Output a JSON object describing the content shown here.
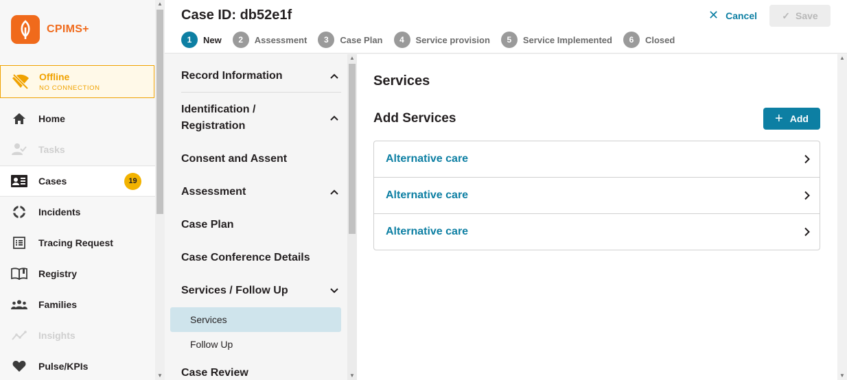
{
  "app": {
    "name": "CPIMS+",
    "brand_color": "#f06a1b",
    "accent_color": "#0d7fa3"
  },
  "connection": {
    "status": "Offline",
    "detail": "NO CONNECTION",
    "color": "#f0a200"
  },
  "nav": {
    "items": [
      {
        "label": "Home",
        "icon": "home-icon",
        "disabled": false
      },
      {
        "label": "Tasks",
        "icon": "tasks-icon",
        "disabled": true
      },
      {
        "label": "Cases",
        "icon": "cases-icon",
        "disabled": false,
        "badge": "19",
        "active": true
      },
      {
        "label": "Incidents",
        "icon": "incidents-icon",
        "disabled": false
      },
      {
        "label": "Tracing Request",
        "icon": "tracing-request-icon",
        "disabled": false
      },
      {
        "label": "Registry",
        "icon": "registry-icon",
        "disabled": false
      },
      {
        "label": "Families",
        "icon": "families-icon",
        "disabled": false
      },
      {
        "label": "Insights",
        "icon": "insights-icon",
        "disabled": true
      },
      {
        "label": "Pulse/KPIs",
        "icon": "heart-icon",
        "disabled": false
      }
    ]
  },
  "header": {
    "title": "Case ID: db52e1f",
    "cancel_label": "Cancel",
    "save_label": "Save",
    "steps": [
      {
        "number": "1",
        "label": "New",
        "current": true
      },
      {
        "number": "2",
        "label": "Assessment"
      },
      {
        "number": "3",
        "label": "Case Plan"
      },
      {
        "number": "4",
        "label": "Service provision"
      },
      {
        "number": "5",
        "label": "Service Implemented"
      },
      {
        "number": "6",
        "label": "Closed"
      }
    ]
  },
  "sections": {
    "items": [
      {
        "label": "Record Information",
        "chevron": "up"
      },
      {
        "label": "Identification / Registration",
        "chevron": "up"
      },
      {
        "label": "Consent and Assent",
        "chevron": ""
      },
      {
        "label": "Assessment",
        "chevron": "up"
      },
      {
        "label": "Case Plan",
        "chevron": ""
      },
      {
        "label": "Case Conference Details",
        "chevron": ""
      },
      {
        "label": "Services / Follow Up",
        "chevron": "down"
      },
      {
        "label": "Case Review",
        "chevron": ""
      }
    ],
    "sub_items": [
      {
        "label": "Services",
        "selected": true
      },
      {
        "label": "Follow Up",
        "selected": false
      }
    ]
  },
  "main": {
    "title": "Services",
    "add_title": "Add Services",
    "add_button_label": "Add",
    "services": [
      {
        "name": "Alternative care"
      },
      {
        "name": "Alternative care"
      },
      {
        "name": "Alternative care"
      }
    ]
  }
}
